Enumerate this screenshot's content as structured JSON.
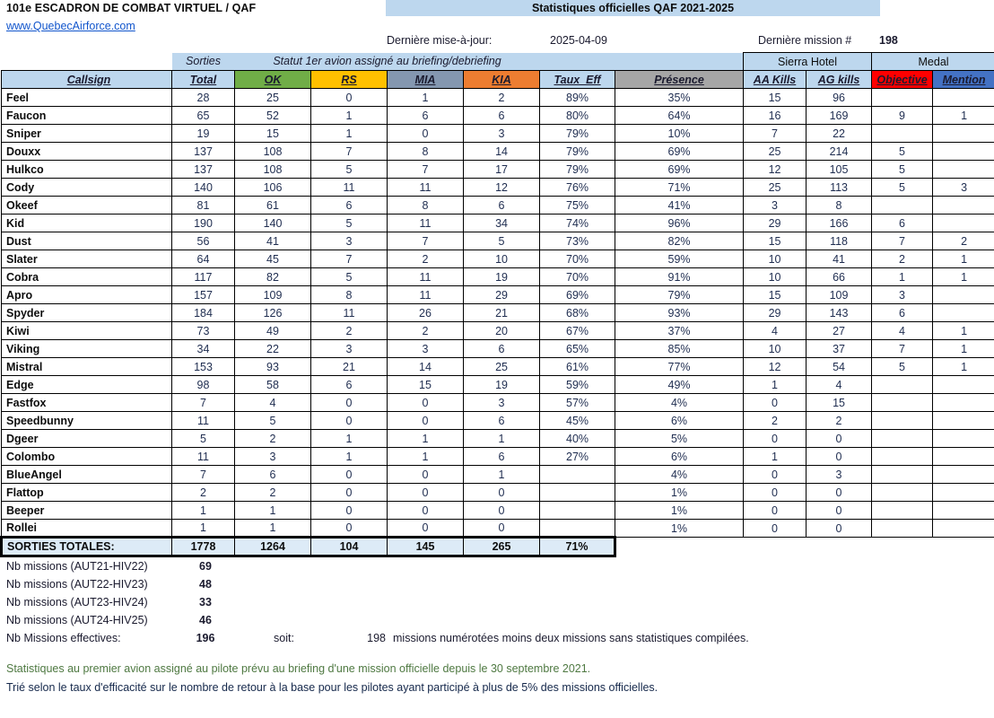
{
  "header": {
    "squadron_title": "101e ESCADRON DE COMBAT VIRTUEL / QAF",
    "site_link": "www.QuebecAirforce.com",
    "banner_title": "Statistiques officielles QAF 2021-2025"
  },
  "meta": {
    "last_update_label": "Dernière mise-à-jour:",
    "last_update_value": "2025-04-09",
    "last_mission_label": "Dernière mission #",
    "last_mission_value": "198"
  },
  "group_headers": {
    "sorties": "Sorties",
    "statut": "Statut 1er avion assigné au briefing/debriefing",
    "sierra_hotel": "Sierra Hotel",
    "medal": "Medal"
  },
  "columns": [
    "Callsign",
    "Total",
    "OK",
    "RS",
    "MIA",
    "KIA",
    "Taux_Eff",
    "Présence",
    "AA Kills",
    "AG kills",
    "Objective",
    "Mention"
  ],
  "colors": {
    "banner": "#bdd7ee",
    "ok": "#70ad47",
    "rs": "#ffc000",
    "mia": "#8497b0",
    "kia": "#ed7d31",
    "taux": "#bdd7ee",
    "presence": "#a6a6a6",
    "objective": "#ff0000",
    "mention": "#4472c4",
    "link": "#1155cc",
    "note_green": "#4f7942"
  },
  "rows": [
    {
      "callsign": "Feel",
      "total": "28",
      "ok": "25",
      "rs": "0",
      "mia": "1",
      "kia": "2",
      "taux": "89%",
      "presence": "35%",
      "aa": "15",
      "ag": "96",
      "objective": "",
      "mention": ""
    },
    {
      "callsign": "Faucon",
      "total": "65",
      "ok": "52",
      "rs": "1",
      "mia": "6",
      "kia": "6",
      "taux": "80%",
      "presence": "64%",
      "aa": "16",
      "ag": "169",
      "objective": "9",
      "mention": "1"
    },
    {
      "callsign": "Sniper",
      "total": "19",
      "ok": "15",
      "rs": "1",
      "mia": "0",
      "kia": "3",
      "taux": "79%",
      "presence": "10%",
      "aa": "7",
      "ag": "22",
      "objective": "",
      "mention": ""
    },
    {
      "callsign": "Douxx",
      "total": "137",
      "ok": "108",
      "rs": "7",
      "mia": "8",
      "kia": "14",
      "taux": "79%",
      "presence": "69%",
      "aa": "25",
      "ag": "214",
      "objective": "5",
      "mention": ""
    },
    {
      "callsign": "Hulkco",
      "total": "137",
      "ok": "108",
      "rs": "5",
      "mia": "7",
      "kia": "17",
      "taux": "79%",
      "presence": "69%",
      "aa": "12",
      "ag": "105",
      "objective": "5",
      "mention": ""
    },
    {
      "callsign": "Cody",
      "total": "140",
      "ok": "106",
      "rs": "11",
      "mia": "11",
      "kia": "12",
      "taux": "76%",
      "presence": "71%",
      "aa": "25",
      "ag": "113",
      "objective": "5",
      "mention": "3"
    },
    {
      "callsign": "Okeef",
      "total": "81",
      "ok": "61",
      "rs": "6",
      "mia": "8",
      "kia": "6",
      "taux": "75%",
      "presence": "41%",
      "aa": "3",
      "ag": "8",
      "objective": "",
      "mention": ""
    },
    {
      "callsign": "Kid",
      "total": "190",
      "ok": "140",
      "rs": "5",
      "mia": "11",
      "kia": "34",
      "taux": "74%",
      "presence": "96%",
      "aa": "29",
      "ag": "166",
      "objective": "6",
      "mention": ""
    },
    {
      "callsign": "Dust",
      "total": "56",
      "ok": "41",
      "rs": "3",
      "mia": "7",
      "kia": "5",
      "taux": "73%",
      "presence": "82%",
      "aa": "15",
      "ag": "118",
      "objective": "7",
      "mention": "2"
    },
    {
      "callsign": "Slater",
      "total": "64",
      "ok": "45",
      "rs": "7",
      "mia": "2",
      "kia": "10",
      "taux": "70%",
      "presence": "59%",
      "aa": "10",
      "ag": "41",
      "objective": "2",
      "mention": "1"
    },
    {
      "callsign": "Cobra",
      "total": "117",
      "ok": "82",
      "rs": "5",
      "mia": "11",
      "kia": "19",
      "taux": "70%",
      "presence": "91%",
      "aa": "10",
      "ag": "66",
      "objective": "1",
      "mention": "1"
    },
    {
      "callsign": "Apro",
      "total": "157",
      "ok": "109",
      "rs": "8",
      "mia": "11",
      "kia": "29",
      "taux": "69%",
      "presence": "79%",
      "aa": "15",
      "ag": "109",
      "objective": "3",
      "mention": ""
    },
    {
      "callsign": "Spyder",
      "total": "184",
      "ok": "126",
      "rs": "11",
      "mia": "26",
      "kia": "21",
      "taux": "68%",
      "presence": "93%",
      "aa": "29",
      "ag": "143",
      "objective": "6",
      "mention": ""
    },
    {
      "callsign": "Kiwi",
      "total": "73",
      "ok": "49",
      "rs": "2",
      "mia": "2",
      "kia": "20",
      "taux": "67%",
      "presence": "37%",
      "aa": "4",
      "ag": "27",
      "objective": "4",
      "mention": "1"
    },
    {
      "callsign": "Viking",
      "total": "34",
      "ok": "22",
      "rs": "3",
      "mia": "3",
      "kia": "6",
      "taux": "65%",
      "presence": "85%",
      "aa": "10",
      "ag": "37",
      "objective": "7",
      "mention": "1"
    },
    {
      "callsign": "Mistral",
      "total": "153",
      "ok": "93",
      "rs": "21",
      "mia": "14",
      "kia": "25",
      "taux": "61%",
      "presence": "77%",
      "aa": "12",
      "ag": "54",
      "objective": "5",
      "mention": "1"
    },
    {
      "callsign": "Edge",
      "total": "98",
      "ok": "58",
      "rs": "6",
      "mia": "15",
      "kia": "19",
      "taux": "59%",
      "presence": "49%",
      "aa": "1",
      "ag": "4",
      "objective": "",
      "mention": ""
    },
    {
      "callsign": "Fastfox",
      "total": "7",
      "ok": "4",
      "rs": "0",
      "mia": "0",
      "kia": "3",
      "taux": "57%",
      "presence": "4%",
      "aa": "0",
      "ag": "15",
      "objective": "",
      "mention": ""
    },
    {
      "callsign": "Speedbunny",
      "total": "11",
      "ok": "5",
      "rs": "0",
      "mia": "0",
      "kia": "6",
      "taux": "45%",
      "presence": "6%",
      "aa": "2",
      "ag": "2",
      "objective": "",
      "mention": ""
    },
    {
      "callsign": "Dgeer",
      "total": "5",
      "ok": "2",
      "rs": "1",
      "mia": "1",
      "kia": "1",
      "taux": "40%",
      "presence": "5%",
      "aa": "0",
      "ag": "0",
      "objective": "",
      "mention": ""
    },
    {
      "callsign": "Colombo",
      "total": "11",
      "ok": "3",
      "rs": "1",
      "mia": "1",
      "kia": "6",
      "taux": "27%",
      "presence": "6%",
      "aa": "1",
      "ag": "0",
      "objective": "",
      "mention": ""
    },
    {
      "callsign": "BlueAngel",
      "total": "7",
      "ok": "6",
      "rs": "0",
      "mia": "0",
      "kia": "1",
      "taux": "",
      "presence": "4%",
      "aa": "0",
      "ag": "3",
      "objective": "",
      "mention": ""
    },
    {
      "callsign": "Flattop",
      "total": "2",
      "ok": "2",
      "rs": "0",
      "mia": "0",
      "kia": "0",
      "taux": "",
      "presence": "1%",
      "aa": "0",
      "ag": "0",
      "objective": "",
      "mention": ""
    },
    {
      "callsign": "Beeper",
      "total": "1",
      "ok": "1",
      "rs": "0",
      "mia": "0",
      "kia": "0",
      "taux": "",
      "presence": "1%",
      "aa": "0",
      "ag": "0",
      "objective": "",
      "mention": ""
    },
    {
      "callsign": "Rollei",
      "total": "1",
      "ok": "1",
      "rs": "0",
      "mia": "0",
      "kia": "0",
      "taux": "",
      "presence": "1%",
      "aa": "0",
      "ag": "0",
      "objective": "",
      "mention": ""
    }
  ],
  "totals": {
    "label": "SORTIES TOTALES:",
    "total": "1778",
    "ok": "1264",
    "rs": "104",
    "mia": "145",
    "kia": "265",
    "taux": "71%"
  },
  "mission_counts": [
    {
      "label": "Nb missions (AUT21-HIV22)",
      "value": "69"
    },
    {
      "label": "Nb missions (AUT22-HIV23)",
      "value": "48"
    },
    {
      "label": "Nb missions (AUT23-HIV24)",
      "value": "33"
    },
    {
      "label": "Nb missions (AUT24-HIV25)",
      "value": "46"
    }
  ],
  "effective": {
    "label": "Nb Missions effectives:",
    "value": "196",
    "soit": "soit:",
    "count": "198",
    "tail": "missions numérotées moins deux missions sans statistiques compilées."
  },
  "notes": [
    "Statistiques au premier avion assigné au pilote prévu au briefing d'une mission officielle depuis le 30 septembre 2021.",
    "Trié selon le taux d'efficacité sur le nombre de retour à la base pour les pilotes ayant participé à plus de 5% des missions officielles."
  ]
}
